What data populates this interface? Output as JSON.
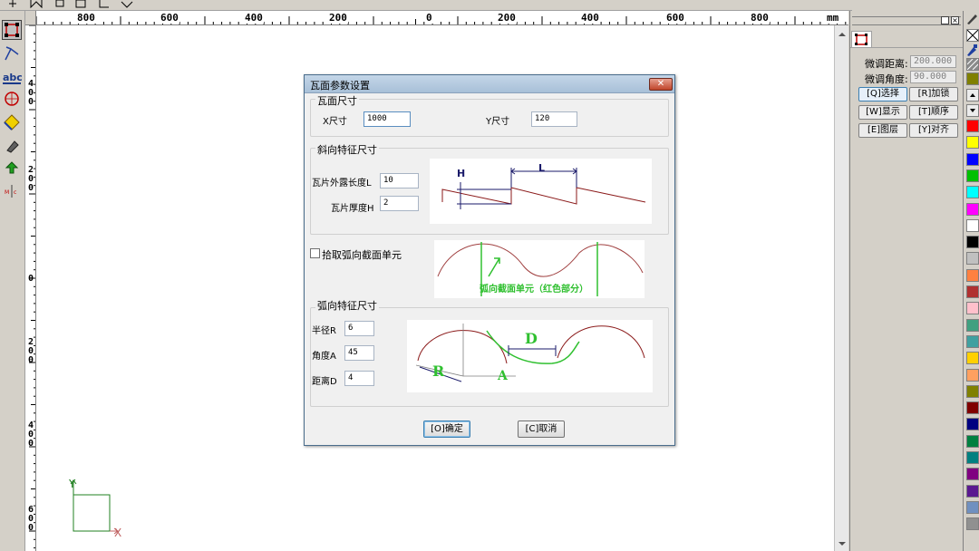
{
  "rulers": {
    "unit": "mm",
    "h_labels": [
      "800",
      "600",
      "400",
      "200",
      "0",
      "200",
      "400",
      "600",
      "800"
    ],
    "v_labels": [
      "4\n0\n0",
      "2\n0\n0",
      "0",
      "2\n0\n0",
      "4\n0\n0",
      "6\n0\n0"
    ]
  },
  "left_toolbar": {
    "tools": [
      "rectangle-select-icon",
      "node-edit-icon",
      "text-tool-icon",
      "circle-tool-icon",
      "fill-tool-icon",
      "eraser-icon",
      "layer-tool-icon",
      "dimension-tool-icon"
    ]
  },
  "axis_indicator": {
    "x": "X",
    "y": "Y"
  },
  "right_panel": {
    "fine_distance_label": "微调距离:",
    "fine_distance_value": "200.000",
    "fine_angle_label": "微调角度:",
    "fine_angle_value": "90.000",
    "buttons": [
      "[Q]选择",
      "[R]加锁",
      "[W]显示",
      "[T]顺序",
      "[E]图层",
      "[Y]对齐"
    ]
  },
  "colors": {
    "palette": [
      "#ff0000",
      "#ffff00",
      "#0000ff",
      "#00c000",
      "#00ffff",
      "#ff00ff",
      "#ffffff",
      "#000000",
      "#c0c0c0",
      "#ff8040",
      "#b03030",
      "#ffc0cb",
      "#40a080",
      "#40a0a0",
      "#ffd000",
      "#ffa060",
      "#808000",
      "#800000",
      "#000080",
      "#008040",
      "#008080",
      "#800080",
      "#5a1890",
      "#7090c0",
      "#909090"
    ]
  },
  "dialog": {
    "title": "瓦面参数设置",
    "close": "✕",
    "size_group": {
      "title": "瓦面尺寸",
      "x_label": "X尺寸",
      "x_value": "1000",
      "y_label": "Y尺寸",
      "y_value": "120"
    },
    "slope_group": {
      "title": "斜向特征尺寸",
      "length_label": "瓦片外露长度L",
      "length_value": "10",
      "thickness_label": "瓦片厚度H",
      "thickness_value": "2",
      "diagram_h": "H",
      "diagram_l": "L"
    },
    "pick_arc_label": "拾取弧向截面单元",
    "arc_diagram_caption": "弧向截面单元（红色部分）",
    "arc_group": {
      "title": "弧向特征尺寸",
      "radius_label": "半径R",
      "radius_value": "6",
      "angle_label": "角度A",
      "angle_value": "45",
      "distance_label": "距离D",
      "distance_value": "4",
      "diagram_r": "R",
      "diagram_a": "A",
      "diagram_d": "D"
    },
    "ok_label": "[O]确定",
    "cancel_label": "[C]取消"
  }
}
